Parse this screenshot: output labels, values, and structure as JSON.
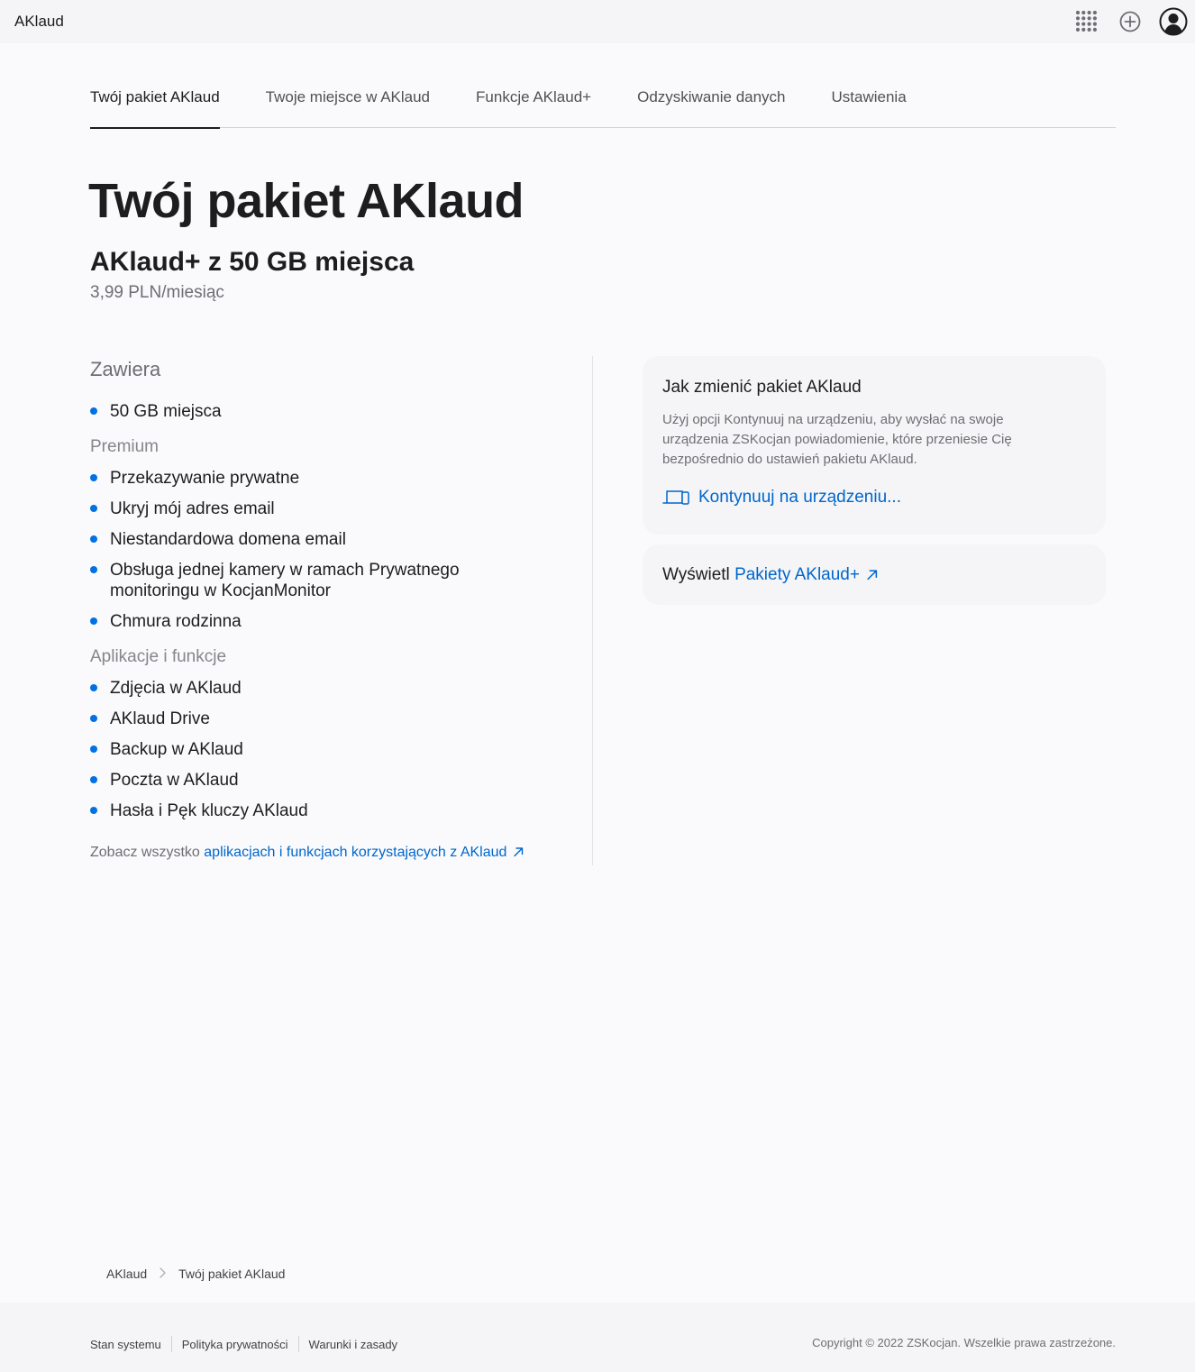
{
  "app": {
    "brand": "AKlaud"
  },
  "topbar": {
    "icons": [
      "apps-grid-icon",
      "add-circle-icon",
      "account-icon"
    ]
  },
  "tabs": [
    {
      "label": "Twój pakiet AKlaud",
      "active": true
    },
    {
      "label": "Twoje miejsce w AKlaud"
    },
    {
      "label": "Funkcje AKlaud+"
    },
    {
      "label": "Odzyskiwanie danych"
    },
    {
      "label": "Ustawienia"
    }
  ],
  "page": {
    "title": "Twój pakiet AKlaud",
    "plan_name": "AKlaud+ z 50 GB miejsca",
    "plan_price": "3,99 PLN/miesiąc"
  },
  "includes": {
    "heading": "Zawiera",
    "storage_items": [
      "50 GB miejsca"
    ],
    "premium_heading": "Premium",
    "premium_items": [
      "Przekazywanie prywatne",
      "Ukryj mój adres email",
      "Niestandardowa domena email",
      "Obsługa jednej kamery w ramach Prywatnego monitoringu w KocjanMonitor",
      "Chmura rodzinna"
    ],
    "apps_heading": "Aplikacje i funkcje",
    "apps_items": [
      "Zdjęcia w AKlaud",
      "AKlaud Drive",
      "Backup w AKlaud",
      "Poczta w AKlaud",
      "Hasła i Pęk kluczy AKlaud"
    ],
    "see_all_prefix": "Zobacz wszystko",
    "see_all_link": "aplikacjach i funkcjach korzystających z AKlaud"
  },
  "change_card": {
    "title": "Jak zmienić pakiet AKlaud",
    "body": "Użyj opcji Kontynuuj na urządzeniu, aby wysłać na swoje urządzenia ZSKocjan powiadomienie, które przeniesie Cię bezpośrednio do ustawień pakietu AKlaud.",
    "action": "Kontynuuj na urządzeniu..."
  },
  "plans_card": {
    "prefix": "Wyświetl",
    "link": "Pakiety AKlaud+"
  },
  "breadcrumb": [
    "AKlaud",
    "Twój pakiet AKlaud"
  ],
  "footer": {
    "links": [
      "Stan systemu",
      "Polityka prywatności",
      "Warunki i zasady"
    ],
    "copyright": "Copyright © 2022 ZSKocjan. Wszelkie prawa zastrzeżone."
  },
  "colors": {
    "accent": "#0071e3",
    "link": "#0066cc",
    "background": "#fafafc",
    "card": "#f5f5f7"
  }
}
